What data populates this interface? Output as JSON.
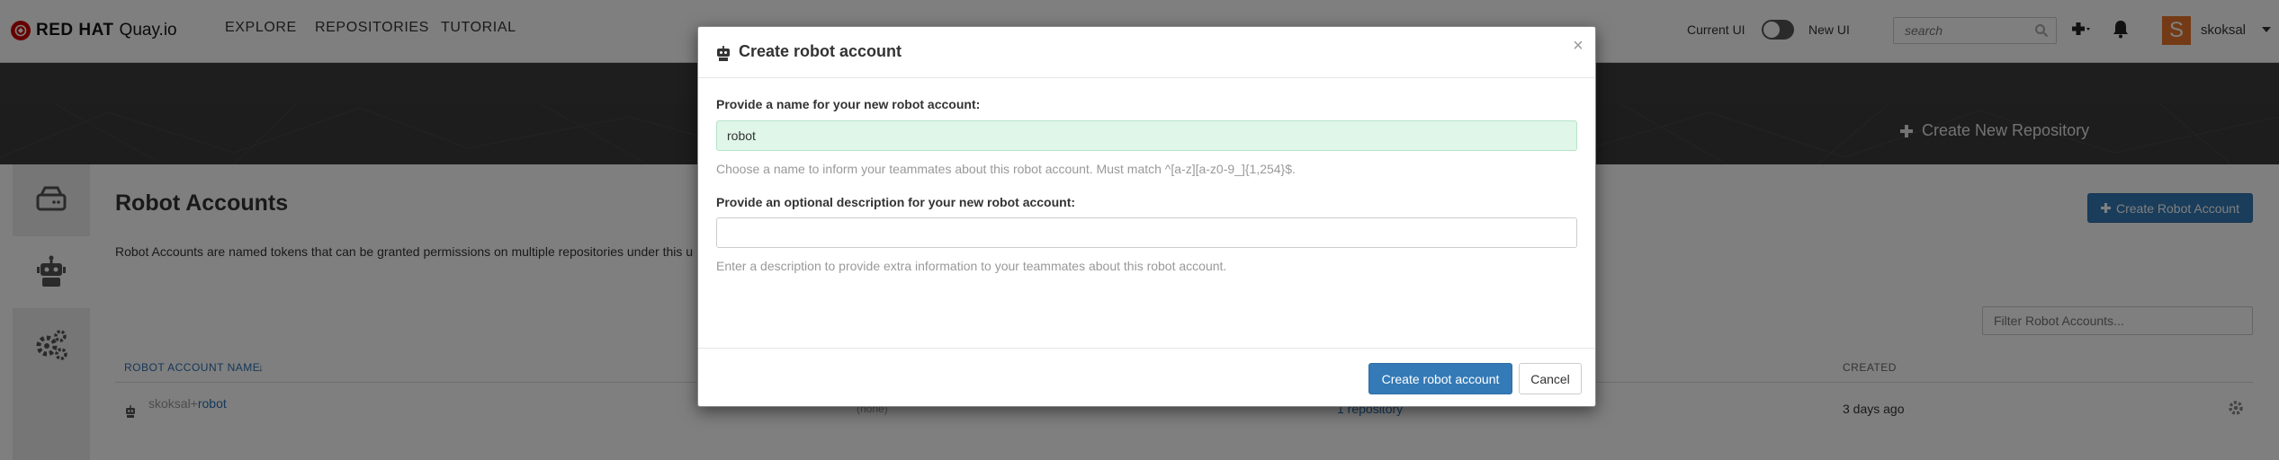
{
  "nav": {
    "brand_red_hat": "RED HAT",
    "brand_product": "Quay.io",
    "links": [
      "EXPLORE",
      "REPOSITORIES",
      "TUTORIAL"
    ],
    "current_ui_label": "Current UI",
    "new_ui_label": "New UI",
    "search_placeholder": "search",
    "user_initial": "S",
    "user_name": "skoksal"
  },
  "header": {
    "create_repo_label": "Create New Repository"
  },
  "page": {
    "title": "Robot Accounts",
    "description": "Robot Accounts are named tokens that can be granted permissions on multiple repositories under this u",
    "create_robot_button": "Create Robot Account",
    "filter_placeholder": "Filter Robot Accounts...",
    "table": {
      "col_name": "ROBOT ACCOUNT NAME",
      "sort_indicator": "↓",
      "col_created": "CREATED",
      "rows": [
        {
          "namespace": "skoksal+",
          "short_name": "robot",
          "description": "(none)",
          "repositories": "1 repository",
          "created": "3 days ago"
        }
      ]
    }
  },
  "modal": {
    "title": "Create robot account",
    "close": "×",
    "name_label": "Provide a name for your new robot account:",
    "name_value": "robot",
    "name_help": "Choose a name to inform your teammates about this robot account. Must match ^[a-z][a-z0-9_]{1,254}$.",
    "description_label": "Provide an optional description for your new robot account:",
    "description_value": "",
    "description_help": "Enter a description to provide extra information to your teammates about this robot account.",
    "submit_label": "Create robot account",
    "cancel_label": "Cancel"
  },
  "colors": {
    "primary": "#337ab7",
    "brand_red": "#cc0000",
    "avatar": "#e8752b",
    "valid_input": "#dff6e8"
  }
}
